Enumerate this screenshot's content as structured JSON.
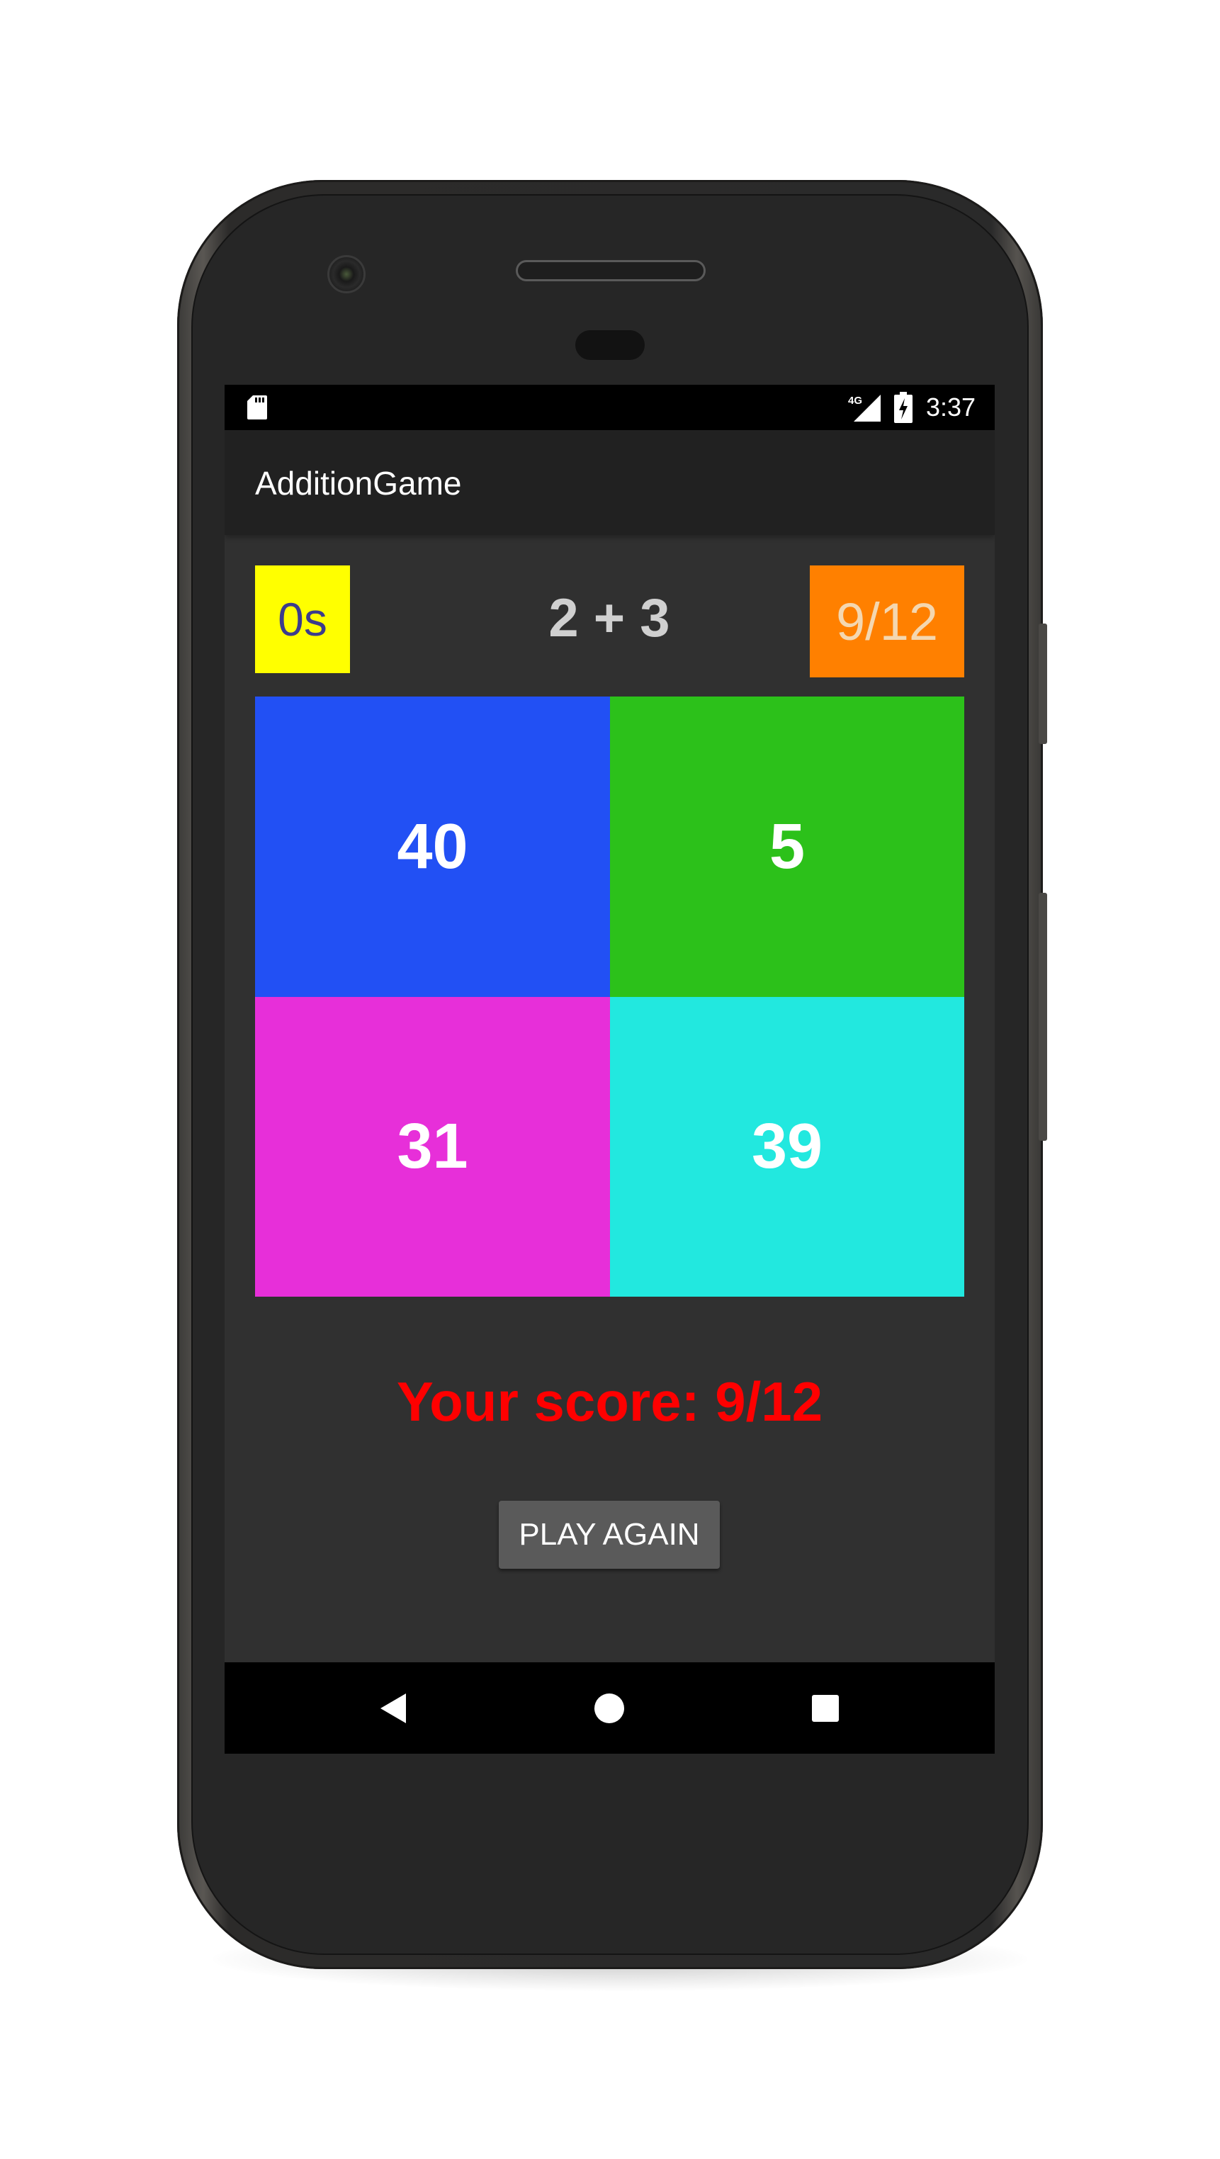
{
  "status_bar": {
    "network": "4G",
    "time": "3:37"
  },
  "app_bar": {
    "title": "AdditionGame"
  },
  "game": {
    "timer": "0s",
    "question": "2 + 3",
    "score": "9/12",
    "answers": [
      {
        "value": "40",
        "color": "#2250f4"
      },
      {
        "value": "5",
        "color": "#2cc11a"
      },
      {
        "value": "31",
        "color": "#e72fd9"
      },
      {
        "value": "39",
        "color": "#22e8df"
      }
    ],
    "result": "Your score: 9/12",
    "play_again_label": "PLAY AGAIN"
  },
  "colors": {
    "timer_bg": "#ffff00",
    "score_bg": "#ff8000",
    "result_text": "#ff0000",
    "screen_bg": "#303030",
    "app_bar_bg": "#212121"
  },
  "icons": {
    "status_left": "sd-card-icon",
    "status_signal": "cell-signal-icon",
    "status_battery": "battery-charging-icon",
    "nav_back": "back-triangle-icon",
    "nav_home": "home-circle-icon",
    "nav_recent": "recent-apps-square-icon"
  }
}
